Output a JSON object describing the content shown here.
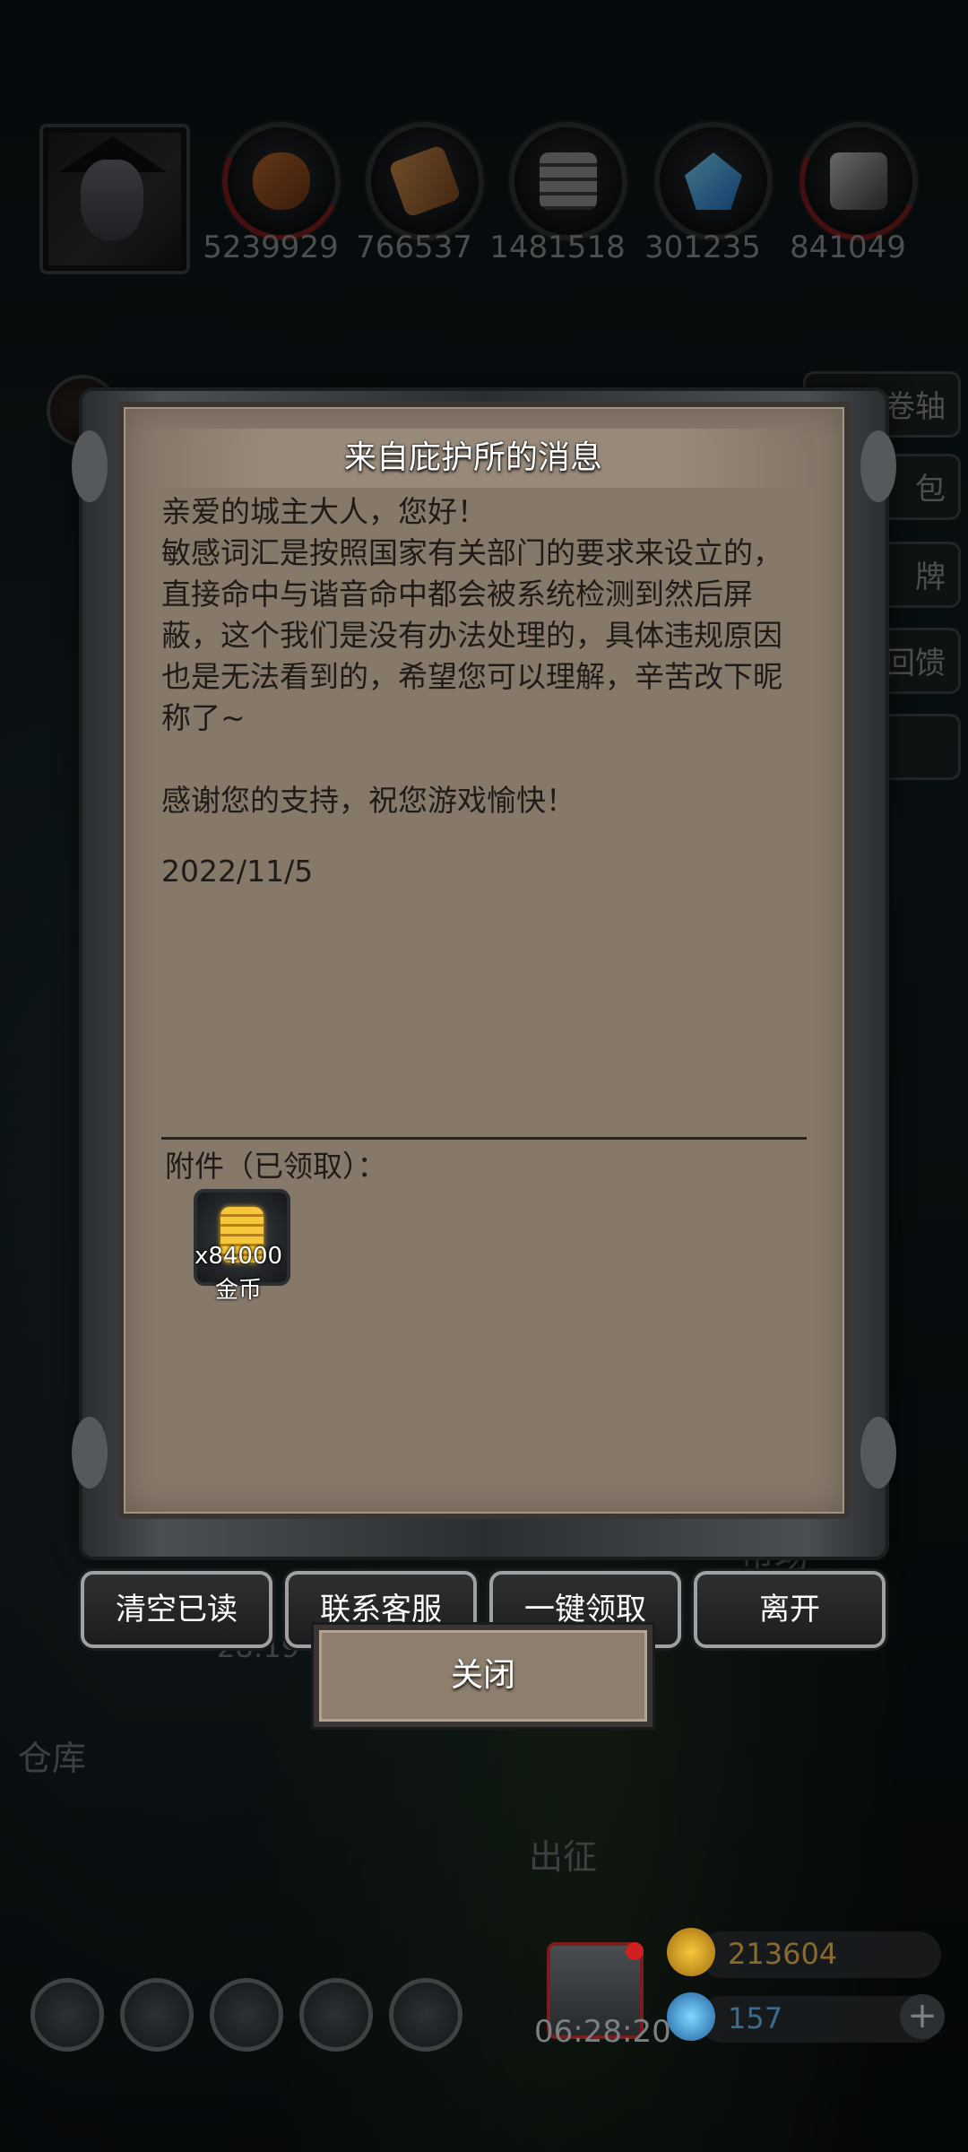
{
  "resources": [
    {
      "icon": "wood-logs-icon",
      "count": "5239929"
    },
    {
      "icon": "planks-icon",
      "count": "766537"
    },
    {
      "icon": "stone-bricks-icon",
      "count": "1481518"
    },
    {
      "icon": "crystal-icon",
      "count": "301235"
    },
    {
      "icon": "iron-ingot-icon",
      "count": "841049"
    }
  ],
  "side_buttons": [
    "卷轴",
    "包",
    "牌",
    "回馈"
  ],
  "dialog": {
    "title": "来自庇护所的消息",
    "body": "亲爱的城主大人，您好！\n敏感词汇是按照国家有关部门的要求来设立的，直接命中与谐音命中都会被系统检测到然后屏蔽，这个我们是没有办法处理的，具体违规原因也是无法看到的，希望您可以理解，辛苦改下昵称了~\n\n感谢您的支持，祝您游戏愉快！",
    "date": "2022/11/5",
    "attachment_label": "附件（已领取）：",
    "attachment": {
      "icon": "gold-coin-stack-icon",
      "qty": "x84000",
      "name": "金币"
    }
  },
  "buttons": {
    "clear_read": "清空已读",
    "contact_support": "联系客服",
    "claim_all": "一键领取",
    "leave": "离开",
    "close": "关闭"
  },
  "background": {
    "warehouse": "仓库",
    "expedition": "出征",
    "market": "市场",
    "timer_partial": "28:19",
    "gift_timer": "06:28:20",
    "gold": "213604",
    "gems": "157"
  }
}
